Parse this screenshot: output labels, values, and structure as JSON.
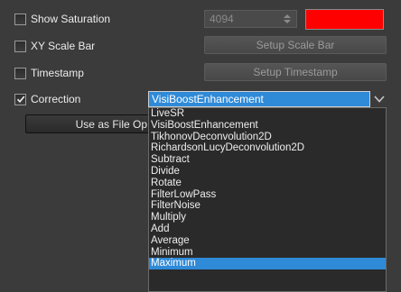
{
  "rows": {
    "show_saturation": {
      "label": "Show Saturation",
      "checked": false
    },
    "xy_scale_bar": {
      "label": "XY Scale Bar",
      "checked": false
    },
    "timestamp": {
      "label": "Timestamp",
      "checked": false
    },
    "correction": {
      "label": "Correction",
      "checked": true
    }
  },
  "saturation_value": "4094",
  "saturation_color": "#ff0000",
  "buttons": {
    "setup_scale_bar": "Setup Scale Bar",
    "setup_timestamp": "Setup Timestamp",
    "use_as_file": "Use as File Op"
  },
  "correction_combo": {
    "selected": "VisiBoostEnhancement",
    "options": [
      "LiveSR",
      "VisiBoostEnhancement",
      "TikhonovDeconvolution2D",
      "RichardsonLucyDeconvolution2D",
      "Subtract",
      "Divide",
      "Rotate",
      "FilterLowPass",
      "FilterNoise",
      "Multiply",
      "Add",
      "Average",
      "Minimum",
      "Maximum"
    ],
    "highlighted": "Maximum"
  },
  "accent_color": "#2f8ad8"
}
